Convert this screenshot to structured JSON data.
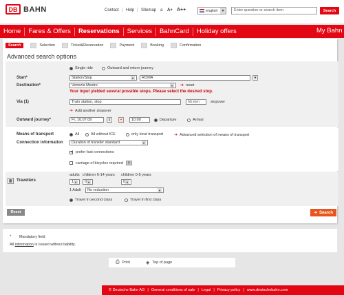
{
  "brand": {
    "logo_text": "DB",
    "name": "BAHN"
  },
  "toplinks": {
    "contact": "Contact",
    "help": "Help",
    "sitemap": "Sitemap",
    "font_small": "a",
    "font_med": "A+",
    "font_large": "A++"
  },
  "language": {
    "value": "english"
  },
  "site_search": {
    "placeholder": "Enter question or search item",
    "button": "Search"
  },
  "nav": {
    "items": [
      "Home",
      "Fares & Offers",
      "Reservations",
      "Services",
      "BahnCard",
      "Holiday offers"
    ],
    "active": "Reservations",
    "mybahn": "My Bahn"
  },
  "steps": [
    "Search",
    "Selection",
    "Ticket&Reservation",
    "Payment",
    "Booking",
    "Confirmation"
  ],
  "page_title": "Advanced search options",
  "journey_type": {
    "single": "Single ride",
    "return": "Outward and return journey"
  },
  "start": {
    "label": "Start*",
    "type_value": "Station/Stop",
    "value": "ROMA"
  },
  "destination": {
    "label": "Destination*",
    "value": "Venezia Mestre",
    "reset": "reset",
    "error": "Your input yielded several possible stops. Please select the desired stop."
  },
  "via": {
    "label": "Via (1)",
    "value": "Train station, stop",
    "time_placeholder": "hh:mm",
    "stopover": "stopover",
    "add": "Add another stopover"
  },
  "outward": {
    "label": "Outward journey*",
    "date": "Fr, 10.07.09",
    "time": "10:00",
    "departure": "Departure",
    "arrival": "Arrival"
  },
  "transport": {
    "label": "Means of transport",
    "all": "All",
    "no_ice": "All without ICE",
    "local": "only local transport",
    "advanced": "Advanced selection of means of transport"
  },
  "connection": {
    "label": "Connection information",
    "duration": "Duration of transfer standard",
    "fast": "prefer fast connections",
    "bicycles": "carriage of bicycles required"
  },
  "travellers": {
    "label": "Travellers",
    "adults_label": "adults",
    "children_label": "children 6-14 years",
    "infants_label": "children 0-5 years",
    "adults": "1",
    "children": "0",
    "infants": "0",
    "adult_row": "1 Adult",
    "reduction": "No reduction",
    "second_class": "Travel in second class",
    "first_class": "Travel in first class"
  },
  "actions": {
    "reset": "Reset",
    "search": "Search"
  },
  "legend": {
    "mark": "*",
    "mandatory": "Mandatory field",
    "liability_pre": "All",
    "liability_link": "information",
    "liability_post": "is issued without liability."
  },
  "utility": {
    "print": "Print",
    "top": "Top of page"
  },
  "footer": [
    "© Deutsche Bahn AG",
    "General conditions of sale",
    "Legal",
    "Privacy policy",
    "www.deutschebahn.com"
  ]
}
